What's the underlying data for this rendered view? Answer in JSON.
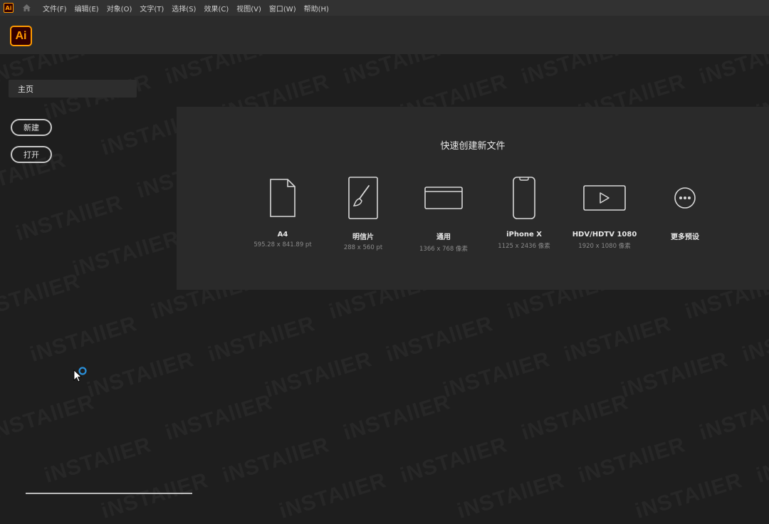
{
  "menubar": {
    "app_badge": "Ai",
    "items": [
      "文件(F)",
      "编辑(E)",
      "对象(O)",
      "文字(T)",
      "选择(S)",
      "效果(C)",
      "视图(V)",
      "窗口(W)",
      "帮助(H)"
    ]
  },
  "logo": {
    "text": "Ai"
  },
  "sidebar": {
    "home_label": "主页",
    "new_label": "新建",
    "open_label": "打开"
  },
  "quick_create": {
    "title": "快速创建新文件",
    "presets": [
      {
        "name": "A4",
        "size": "595.28 x 841.89 pt",
        "icon": "document-icon"
      },
      {
        "name": "明信片",
        "size": "288 x 560 pt",
        "icon": "paintbrush-card-icon"
      },
      {
        "name": "通用",
        "size": "1366 x 768 像素",
        "icon": "browser-window-icon"
      },
      {
        "name": "iPhone X",
        "size": "1125 x 2436 像素",
        "icon": "phone-icon"
      },
      {
        "name": "HDV/HDTV 1080",
        "size": "1920 x 1080 像素",
        "icon": "video-play-icon"
      },
      {
        "name": "更多预设",
        "size": "",
        "icon": "more-dots-icon"
      }
    ]
  },
  "watermark": "iNSTAllER",
  "colors": {
    "accent": "#ff9a00",
    "logo_bg": "#330000",
    "background": "#1e1e1e",
    "panel": "#2a2a2a"
  }
}
